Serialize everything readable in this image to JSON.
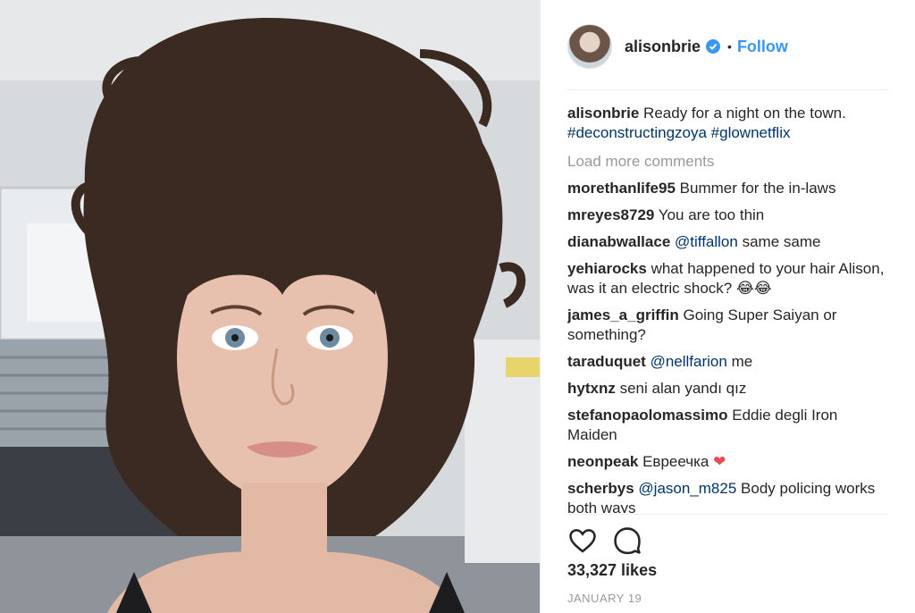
{
  "post": {
    "photo_icon": "portrait-photo",
    "author": "alisonbrie",
    "verified_icon": "verified-badge-icon",
    "follow_label": "Follow",
    "separator": "•",
    "caption": {
      "user": "alisonbrie",
      "text": "Ready for a night on the town.",
      "hashtags": "#deconstructingzoya #glownetflix"
    },
    "load_more_label": "Load more comments",
    "comments": [
      {
        "user": "morethanlife95",
        "text": "Bummer for the in-laws"
      },
      {
        "user": "mreyes8729",
        "text": "You are too thin"
      },
      {
        "user": "dianabwallace",
        "mention": "@tiffallon",
        "text": "same same"
      },
      {
        "user": "yehiarocks",
        "text": "what happened to your hair Alison, was it an electric shock?",
        "emoji": "😂😂"
      },
      {
        "user": "james_a_griffin",
        "text": "Going Super Saiyan or something?"
      },
      {
        "user": "taraduquet",
        "mention": "@nellfarion",
        "text": "me"
      },
      {
        "user": "hytxnz",
        "text": "seni alan yandı qız"
      },
      {
        "user": "stefanopaolomassimo",
        "text": "Eddie degli Iron Maiden"
      },
      {
        "user": "neonpeak",
        "text": "Евреечка",
        "emoji": "❤"
      },
      {
        "user": "scherbys",
        "mention": "@jason_m825",
        "text": "Body policing works both ways"
      }
    ],
    "likes": "33,327 likes",
    "date": "JANUARY 19"
  },
  "colors": {
    "link_blue": "#3897f0",
    "hashtag_blue": "#003569",
    "muted_gray": "#999999",
    "heart_red": "#ed4956"
  },
  "icons": [
    "heart-outline-icon",
    "comment-bubble-icon"
  ]
}
